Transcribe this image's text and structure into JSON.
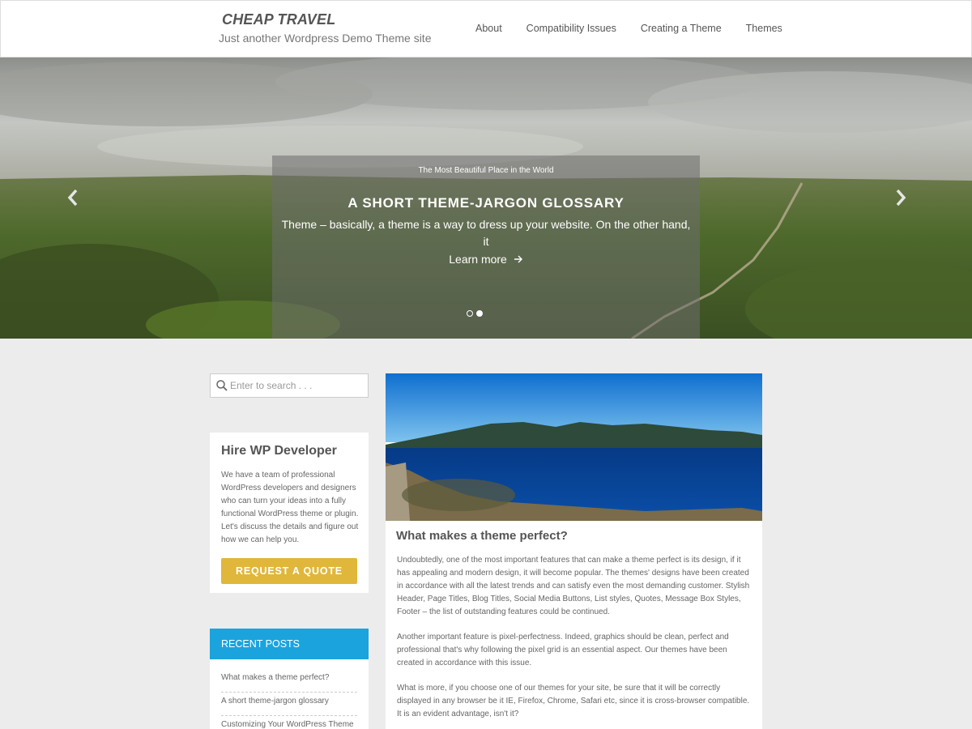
{
  "header": {
    "title": "CHEAP TRAVEL",
    "tagline": "Just another Wordpress Demo Theme site",
    "nav": [
      "About",
      "Compatibility Issues",
      "Creating a Theme",
      "Themes"
    ]
  },
  "hero": {
    "kicker": "The Most Beautiful Place in the World",
    "title": "A SHORT THEME-JARGON GLOSSARY",
    "excerpt": "Theme – basically, a theme is a way to dress up your website. On the other hand, it",
    "more": "Learn more",
    "arrow_icon": "arrow-right-icon",
    "slides": 2,
    "active_slide": 2
  },
  "sidebar": {
    "search_placeholder": "Enter to search . . .",
    "hire": {
      "title": "Hire WP Developer",
      "text": "We have a team of professional WordPress developers and designers who can turn your ideas into a fully functional WordPress theme or plugin. Let's discuss the details and figure out how we can help you.",
      "button": "REQUEST A QUOTE",
      "button_color": "#e0b73a"
    },
    "recent": {
      "heading": "RECENT POSTS",
      "heading_color": "#1ba3de",
      "items": [
        "What makes a theme perfect?",
        "A short theme-jargon glossary",
        "Customizing Your WordPress Theme"
      ]
    }
  },
  "article": {
    "title": "What makes a theme perfect?",
    "paragraphs": [
      "Undoubtedly, one of the most important features that can make a theme perfect is its design, if it has appealing and modern design, it will become popular. The themes' designs have been created in accordance with all the latest trends and can satisfy even the most demanding customer. Stylish Header, Page Titles, Blog Titles, Social Media Buttons, List styles, Quotes, Message Box Styles, Footer – the list of outstanding features could be continued.",
      "Another important feature is pixel-perfectness. Indeed, graphics should be clean, perfect and professional that's why following the pixel grid is an essential aspect. Our themes have been created in accordance with this issue.",
      "What is more, if you choose one of our themes for your site, be sure that it will be correctly displayed in any browser be it IE, Firefox, Chrome, Safari etc, since it is cross-browser compatible. It is an evident advantage, isn't it?"
    ]
  }
}
